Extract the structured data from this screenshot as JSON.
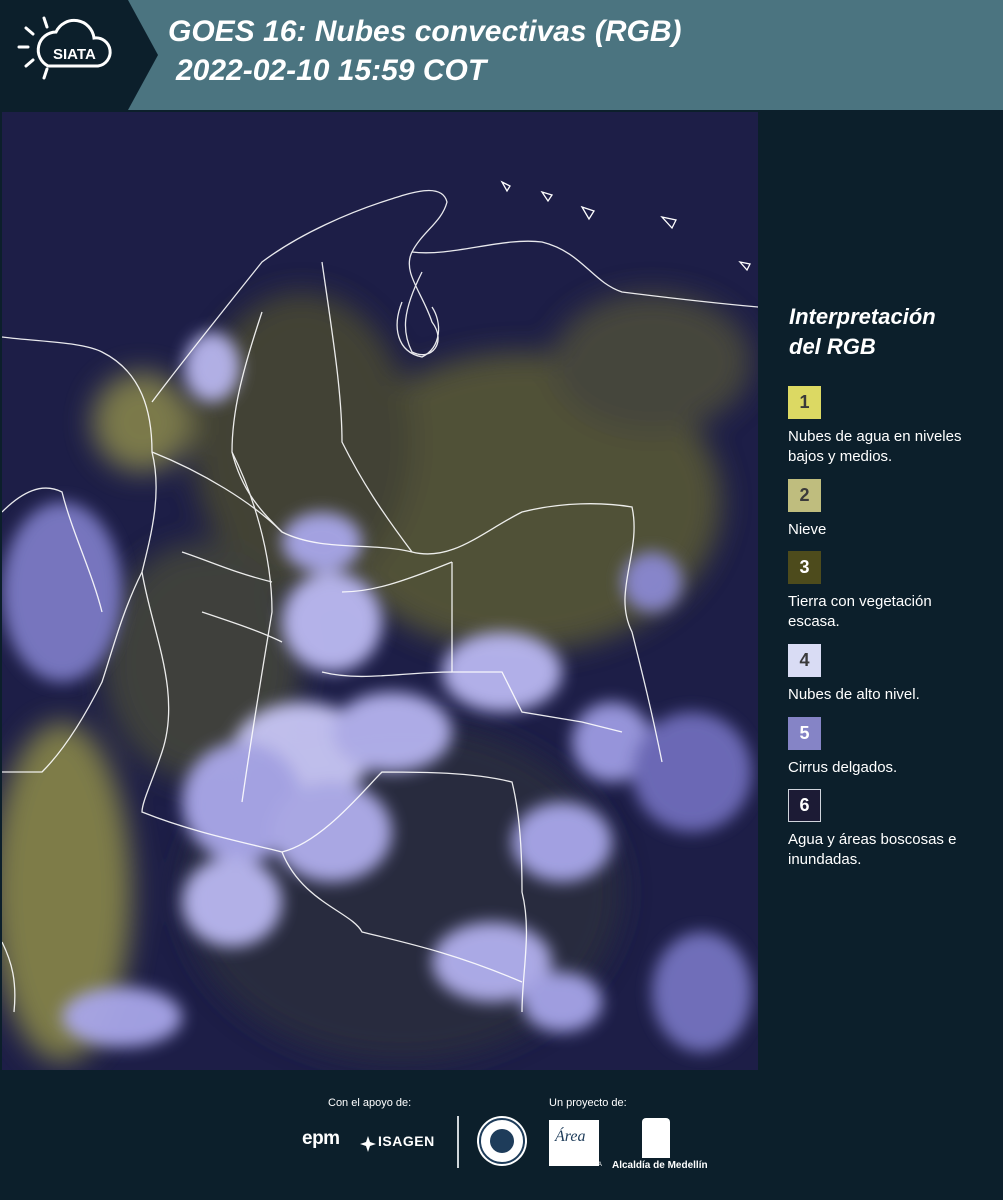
{
  "header": {
    "logo_text": "SIATA",
    "title_line1": "GOES 16: Nubes convectivas (RGB)",
    "title_line2": "2022-02-10 15:59 COT"
  },
  "legend": {
    "title_line1": "Interpretación",
    "title_line2": "del RGB",
    "items": [
      {
        "number": "1",
        "label": "Nubes de agua en niveles bajos y medios.",
        "color": "#dcd963",
        "text_color": "#3a3a3a"
      },
      {
        "number": "2",
        "label": "Nieve",
        "color": "#bfbd7e",
        "text_color": "#3a3a3a"
      },
      {
        "number": "3",
        "label": "Tierra con vegetación escasa.",
        "color": "#4d4b1c",
        "text_color": "#ffffff"
      },
      {
        "number": "4",
        "label": "Nubes de alto nivel.",
        "color": "#d9dcf4",
        "text_color": "#3a3a3a"
      },
      {
        "number": "5",
        "label": "Cirrus delgados.",
        "color": "#8584c6",
        "text_color": "#ffffff"
      },
      {
        "number": "6",
        "label": "Agua y áreas boscosas e inundadas.",
        "color": "#1c1b35",
        "text_color": "#ffffff"
      }
    ]
  },
  "footer": {
    "support_label": "Con el apoyo de:",
    "project_label": "Un proyecto de:",
    "epm_text": "epm",
    "isagen_text": "ISAGEN",
    "area_text": "Área",
    "area_small": "METROPOLITANA",
    "alcaldia_text": "Alcaldía de Medellín"
  }
}
